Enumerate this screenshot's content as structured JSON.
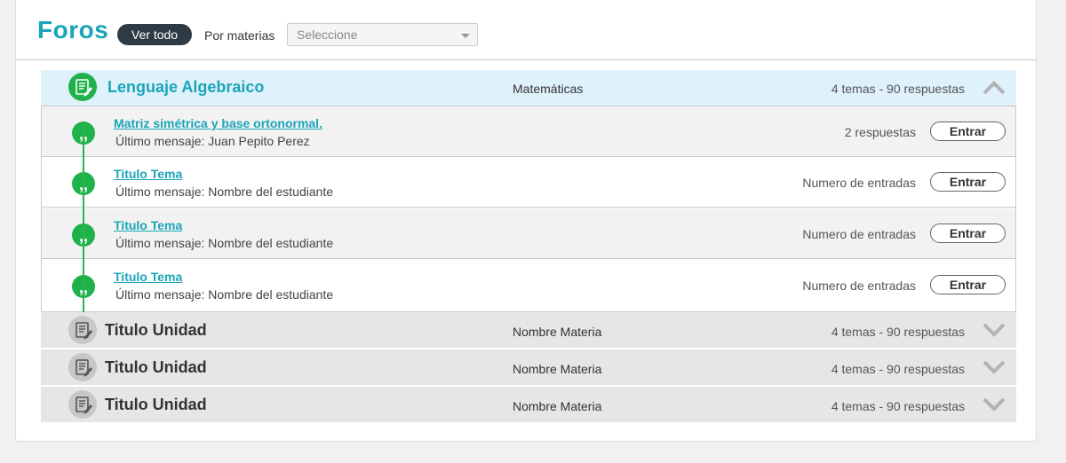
{
  "header": {
    "title": "Foros",
    "view_all": "Ver todo",
    "filter_label": "Por materias",
    "select_placeholder": "Seleccione"
  },
  "open_unit": {
    "name": "Lenguaje Algebraico",
    "subject": "Matemáticas",
    "stats": "4 temas - 90 respuestas",
    "icon": "edit-document-icon",
    "topics": [
      {
        "title": "Matriz simétrica y base ortonormal.",
        "last": "Último mensaje: Juan Pepito Perez",
        "count": "2 respuestas",
        "button": "Entrar"
      },
      {
        "title": "Titulo Tema",
        "last": "Último mensaje: Nombre del estudiante",
        "count": "Numero de entradas",
        "button": "Entrar"
      },
      {
        "title": "Titulo Tema",
        "last": "Último mensaje: Nombre del estudiante",
        "count": "Numero de entradas",
        "button": "Entrar"
      },
      {
        "title": "Titulo Tema",
        "last": "Último mensaje: Nombre del estudiante",
        "count": "Numero de entradas",
        "button": "Entrar"
      }
    ]
  },
  "closed_units": [
    {
      "name": "Titulo Unidad",
      "subject": "Nombre Materia",
      "stats": "4 temas - 90 respuestas"
    },
    {
      "name": "Titulo Unidad",
      "subject": "Nombre Materia",
      "stats": "4 temas - 90 respuestas"
    },
    {
      "name": "Titulo Unidad",
      "subject": "Nombre Materia",
      "stats": "4 temas - 90 respuestas"
    }
  ],
  "colors": {
    "accent": "#1aa5b8",
    "green": "#1fb24a",
    "dark_button": "#2e3b44",
    "open_row": "#dff1fb"
  }
}
